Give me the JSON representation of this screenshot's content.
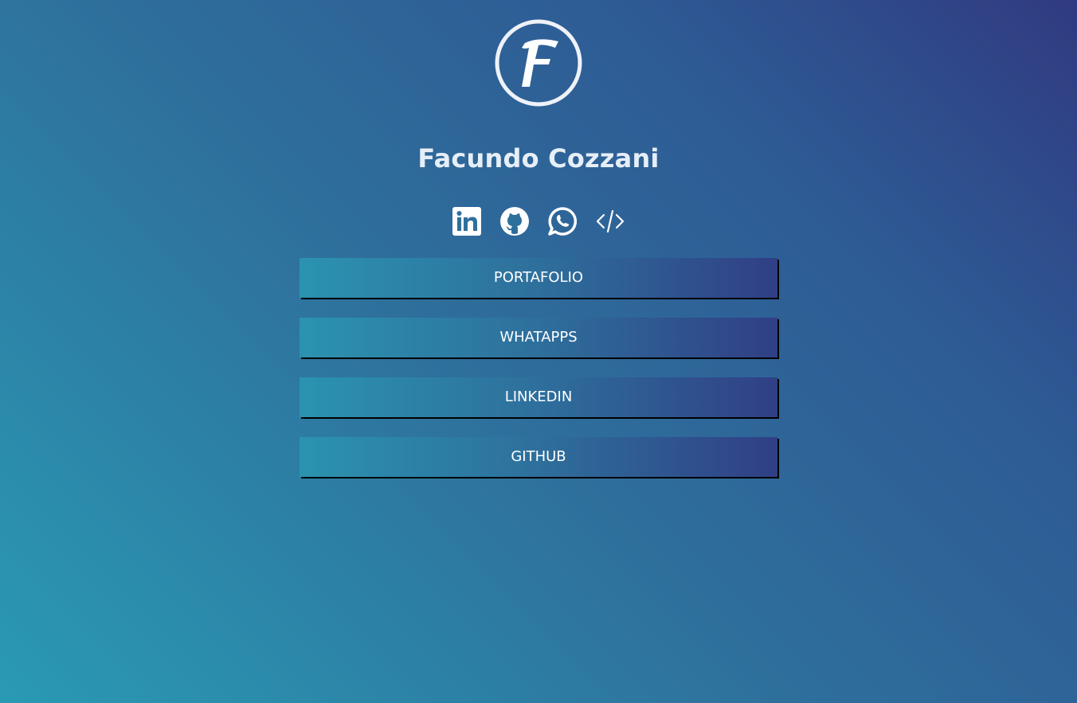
{
  "profile": {
    "logo_letter": "F",
    "name": "Facundo Cozzani"
  },
  "socials": [
    {
      "icon": "linkedin-icon"
    },
    {
      "icon": "github-icon"
    },
    {
      "icon": "whatsapp-icon"
    },
    {
      "icon": "code-icon"
    }
  ],
  "buttons": [
    {
      "label": "PORTAFOLIO"
    },
    {
      "label": "WHATAPPS"
    },
    {
      "label": "LINKEDIN"
    },
    {
      "label": "GITHUB"
    }
  ],
  "colors": {
    "background_start": "#2a9ab3",
    "background_end": "#303a80",
    "button_start": "#2b93b0",
    "button_end": "#303f85",
    "text": "#ffffff"
  }
}
